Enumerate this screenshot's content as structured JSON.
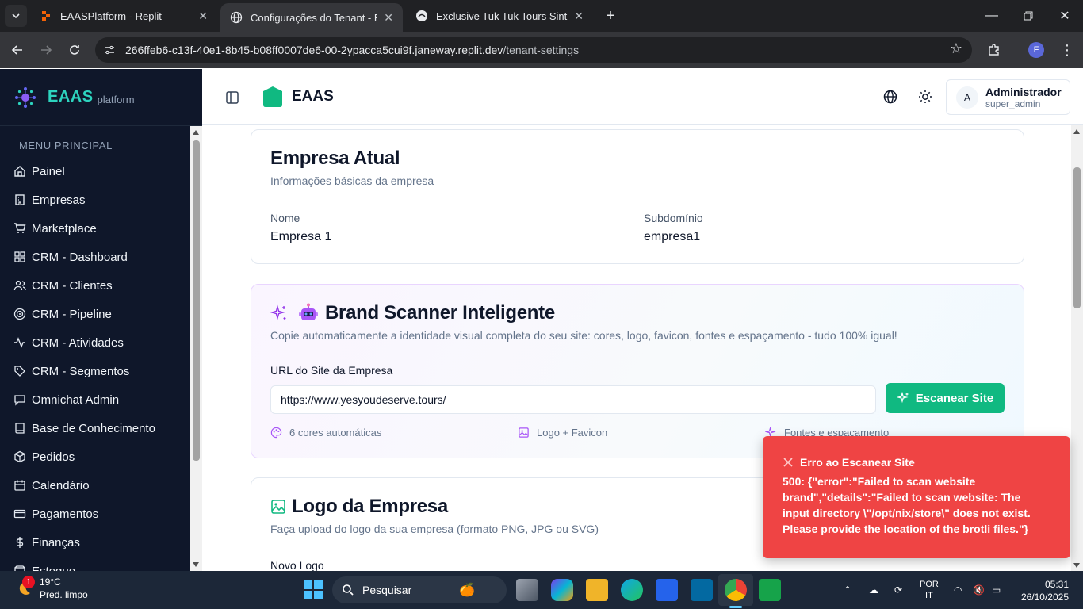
{
  "browser": {
    "tabs": [
      {
        "title": "EAASPlatform - Replit",
        "active": false
      },
      {
        "title": "Configurações do Tenant - EAAS",
        "active": true
      },
      {
        "title": "Exclusive Tuk Tuk Tours Sintra &",
        "active": false
      }
    ],
    "url_host": "266ffeb6-c13f-40e1-8b45-b08ff0007de6-00-2ypacca5cui9f.janeway.replit.dev",
    "url_path": "/tenant-settings",
    "profile_initial": "F"
  },
  "sidebar": {
    "brand_name": "EAAS",
    "brand_sub": "platform",
    "menu_label": "MENU PRINCIPAL",
    "items": [
      {
        "label": "Painel",
        "icon": "home-icon"
      },
      {
        "label": "Empresas",
        "icon": "building-icon"
      },
      {
        "label": "Marketplace",
        "icon": "cart-icon"
      },
      {
        "label": "CRM - Dashboard",
        "icon": "grid-icon"
      },
      {
        "label": "CRM - Clientes",
        "icon": "users-icon"
      },
      {
        "label": "CRM - Pipeline",
        "icon": "target-icon"
      },
      {
        "label": "CRM - Atividades",
        "icon": "activity-icon"
      },
      {
        "label": "CRM - Segmentos",
        "icon": "tag-icon"
      },
      {
        "label": "Omnichat Admin",
        "icon": "chat-icon"
      },
      {
        "label": "Base de Conhecimento",
        "icon": "book-icon"
      },
      {
        "label": "Pedidos",
        "icon": "package-icon"
      },
      {
        "label": "Calendário",
        "icon": "calendar-icon"
      },
      {
        "label": "Pagamentos",
        "icon": "credit-card-icon"
      },
      {
        "label": "Finanças",
        "icon": "dollar-icon"
      },
      {
        "label": "Estoque",
        "icon": "box-icon"
      }
    ]
  },
  "header": {
    "title": "EAAS",
    "user_initial": "A",
    "user_name": "Administrador",
    "user_role": "super_admin"
  },
  "company_card": {
    "title": "Empresa Atual",
    "subtitle": "Informações básicas da empresa",
    "name_label": "Nome",
    "name_value": "Empresa 1",
    "subdomain_label": "Subdomínio",
    "subdomain_value": "empresa1"
  },
  "brand_scanner": {
    "title": "Brand Scanner Inteligente",
    "subtitle": "Copie automaticamente a identidade visual completa do seu site: cores, logo, favicon, fontes e espaçamento - tudo 100% igual!",
    "url_label": "URL do Site da Empresa",
    "url_value": "https://www.yesyoudeserve.tours/",
    "scan_button": "Escanear Site",
    "features": [
      "6 cores automáticas",
      "Logo + Favicon",
      "Fontes e espaçamento"
    ]
  },
  "logo_card": {
    "title": "Logo da Empresa",
    "subtitle": "Faça upload do logo da sua empresa (formato PNG, JPG ou SVG)",
    "new_logo_label": "Novo Logo"
  },
  "toast": {
    "title": "Erro ao Escanear Site",
    "message": "500: {\"error\":\"Failed to scan website brand\",\"details\":\"Failed to scan website: The input directory \\\"/opt/nix/store\\\" does not exist. Please provide the location of the brotli files.\"}"
  },
  "taskbar": {
    "weather_temp": "19°C",
    "weather_desc": "Pred. limpo",
    "weather_badge": "1",
    "search_label": "Pesquisar",
    "lang_1": "POR",
    "lang_2": "IT",
    "time": "05:31",
    "date": "26/10/2025"
  },
  "colors": {
    "sidebar_bg": "#0f172a",
    "accent_green": "#10b981",
    "toast_red": "#ef4444",
    "scanner_purple": "#9333ea"
  }
}
